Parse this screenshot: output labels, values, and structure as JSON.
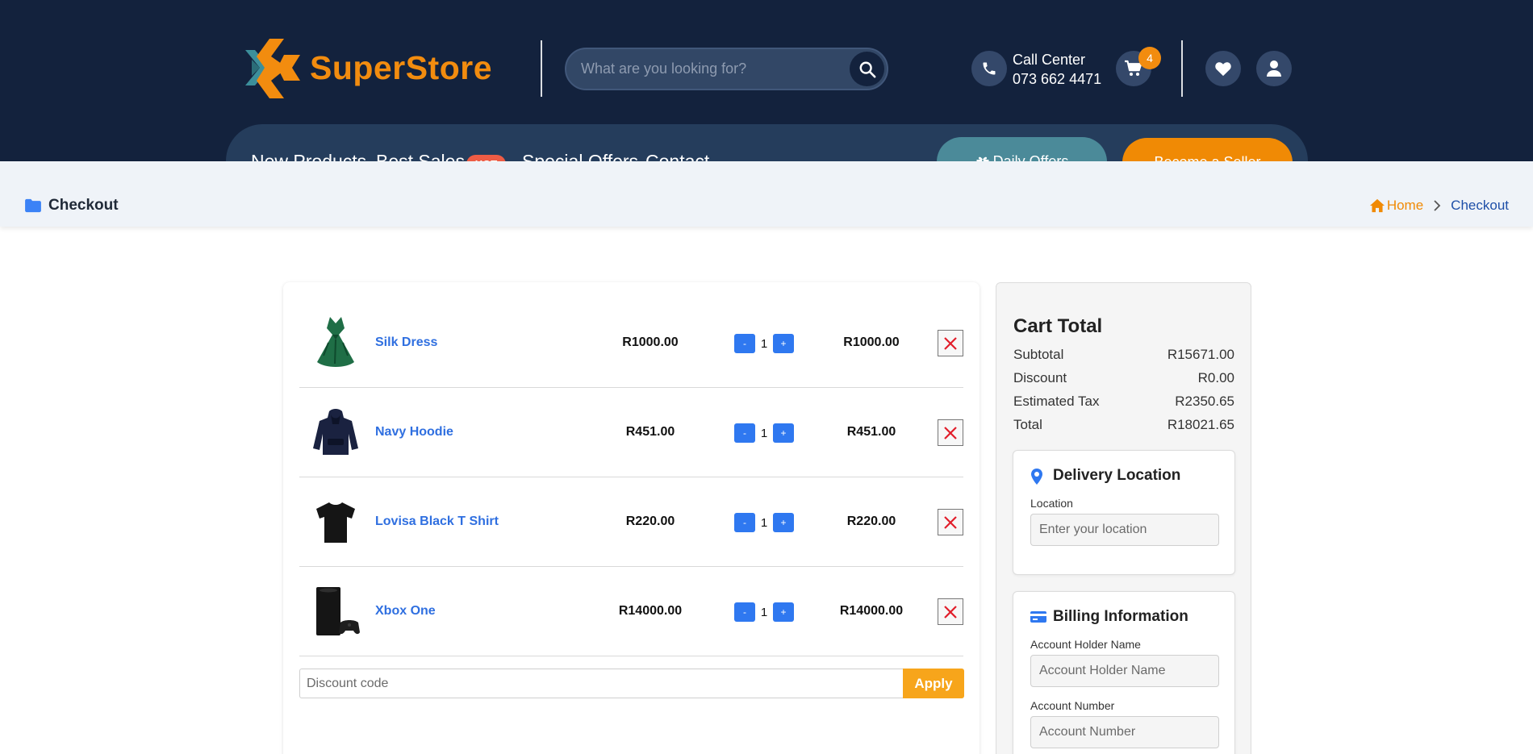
{
  "header": {
    "brand": "SuperStore",
    "search_placeholder": "What are you looking for?",
    "call_center_label": "Call Center",
    "call_center_number": "073 662 4471",
    "cart_count": "4"
  },
  "nav": {
    "links": [
      "New Products",
      "Best Sales",
      "Special Offers",
      "Contact"
    ],
    "hot_badge": "HOT",
    "daily_offers": "Daily Offers",
    "become_seller": "Become a Seller"
  },
  "breadcrumb": {
    "page_title": "Checkout",
    "home": "Home",
    "current": "Checkout"
  },
  "cart": {
    "items": [
      {
        "name": "Silk Dress",
        "price": "R1000.00",
        "qty": "1",
        "total": "R1000.00",
        "image": "green-dress"
      },
      {
        "name": "Navy Hoodie",
        "price": "R451.00",
        "qty": "1",
        "total": "R451.00",
        "image": "navy-hoodie"
      },
      {
        "name": "Lovisa Black T Shirt",
        "price": "R220.00",
        "qty": "1",
        "total": "R220.00",
        "image": "black-tshirt"
      },
      {
        "name": "Xbox One",
        "price": "R14000.00",
        "qty": "1",
        "total": "R14000.00",
        "image": "xbox-console"
      }
    ],
    "minus_label": "-",
    "plus_label": "+",
    "discount_placeholder": "Discount code",
    "apply_label": "Apply"
  },
  "summary": {
    "title": "Cart Total",
    "rows": [
      {
        "label": "Subtotal",
        "value": "R15671.00"
      },
      {
        "label": "Discount",
        "value": "R0.00"
      },
      {
        "label": "Estimated Tax",
        "value": "R2350.65"
      },
      {
        "label": "Total",
        "value": "R18021.65"
      }
    ],
    "delivery": {
      "title": "Delivery Location",
      "location_label": "Location",
      "location_placeholder": "Enter your location"
    },
    "billing": {
      "title": "Billing Information",
      "holder_label": "Account Holder Name",
      "holder_placeholder": "Account Holder Name",
      "number_label": "Account Number",
      "number_placeholder": "Account Number"
    }
  },
  "colors": {
    "header_bg": "#13223d",
    "nav_bg": "#253d5c",
    "accent_orange": "#f08a05",
    "link_blue": "#2f6fe0",
    "teal": "#4b8a99"
  }
}
